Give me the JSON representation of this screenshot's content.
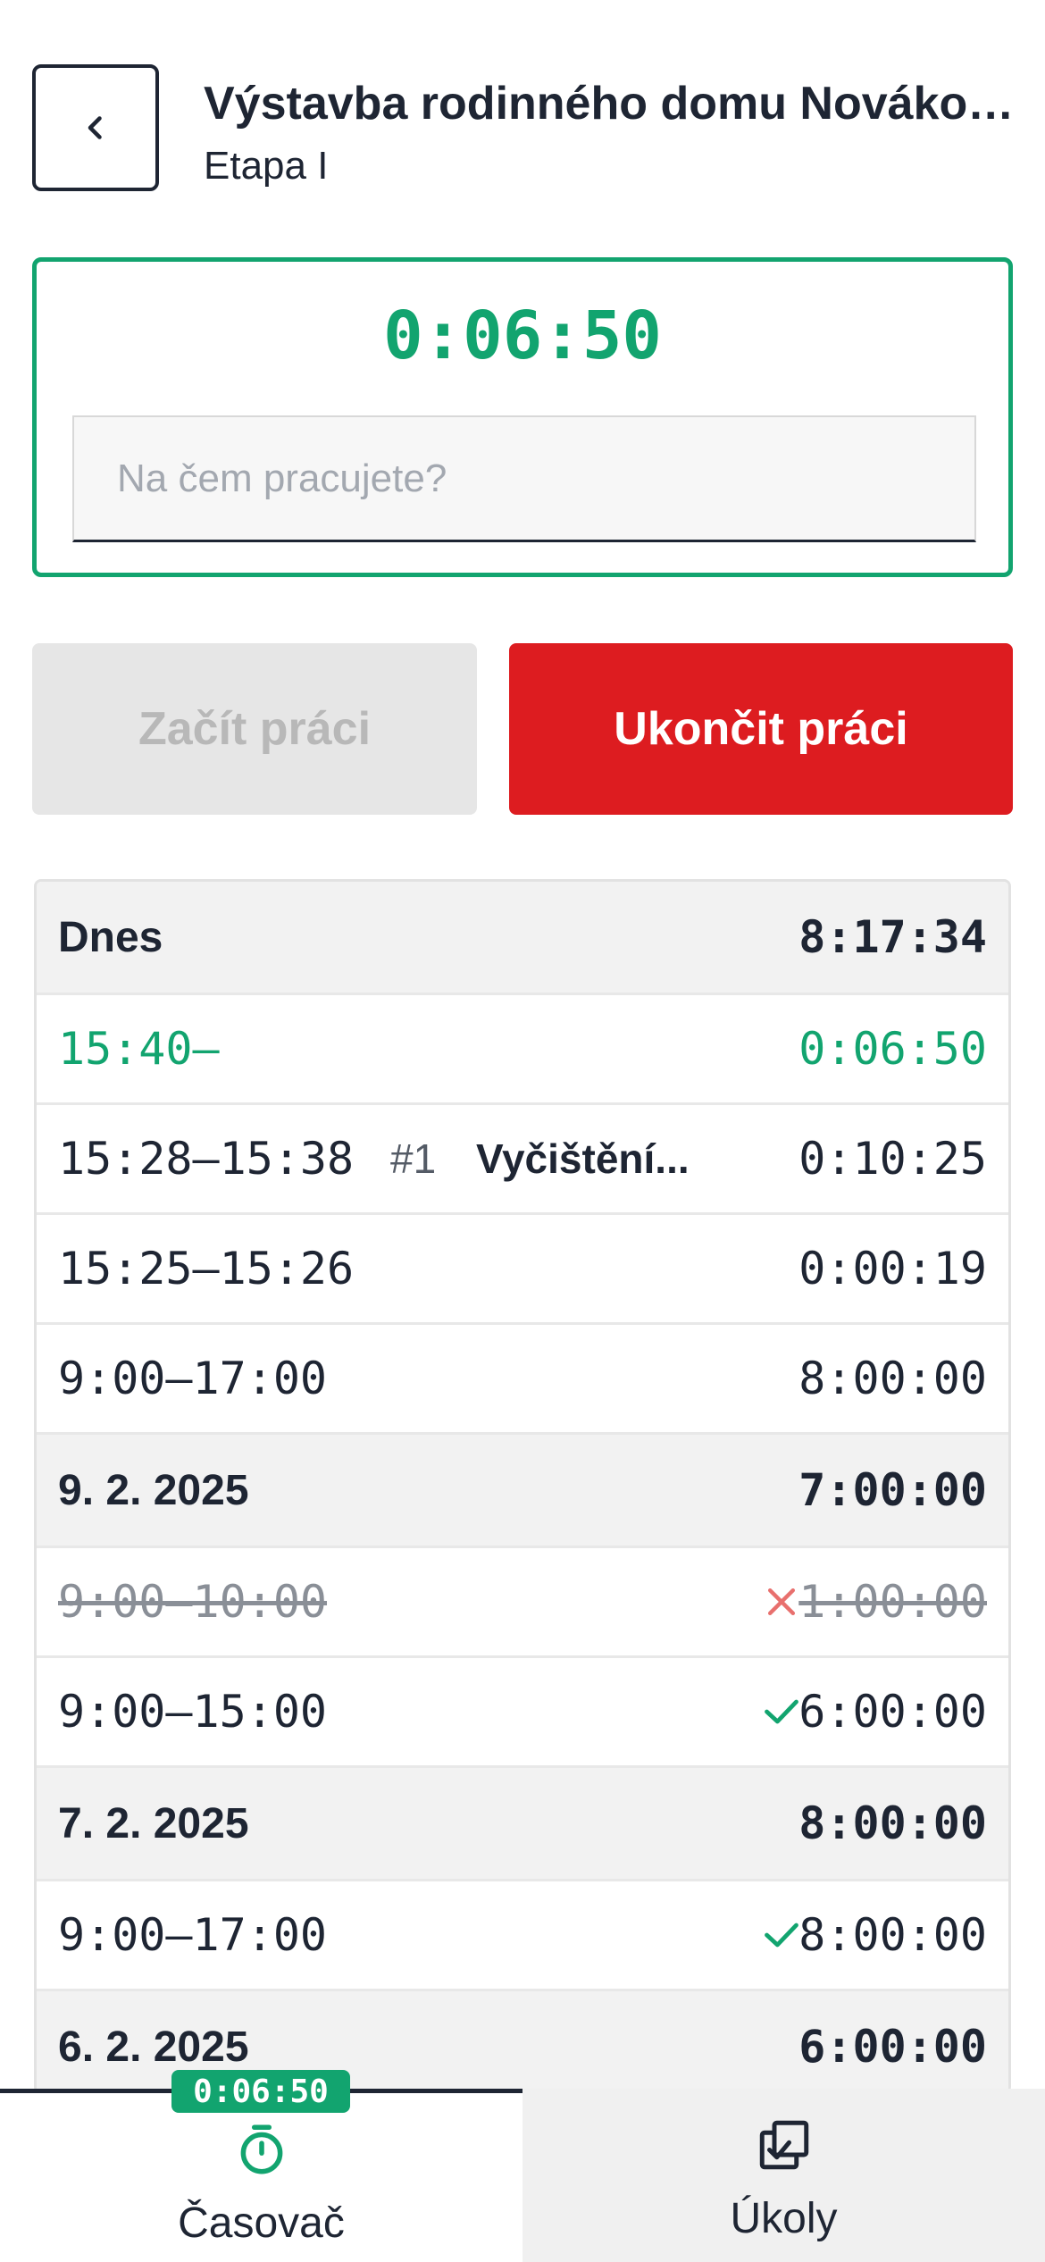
{
  "header": {
    "title": "Výstavba rodinného domu Novákových",
    "subtitle": "Etapa I"
  },
  "timer": {
    "elapsed": "0:06:50",
    "task_placeholder": "Na čem pracujete?",
    "task_value": ""
  },
  "actions": {
    "start_label": "Začít práci",
    "stop_label": "Ukončit práci"
  },
  "entries": {
    "today": {
      "label": "Dnes",
      "total": "8:17:34",
      "rows": [
        {
          "range": "15:40–",
          "duration": "0:06:50"
        },
        {
          "range": "15:28–15:38",
          "task_number": "#1",
          "task_name": "Vyčištění...",
          "duration": "0:10:25"
        },
        {
          "range": "15:25–15:26",
          "duration": "0:00:19"
        },
        {
          "range": "9:00–17:00",
          "duration": "8:00:00"
        }
      ]
    },
    "day_9_2": {
      "label": "9. 2. 2025",
      "total": "7:00:00",
      "rows": [
        {
          "range": "9:00–10:00",
          "duration": "1:00:00",
          "status_icon": "close-icon"
        },
        {
          "range": "9:00–15:00",
          "duration": "6:00:00",
          "status_icon": "check-icon"
        }
      ]
    },
    "day_7_2": {
      "label": "7. 2. 2025",
      "total": "8:00:00",
      "rows": [
        {
          "range": "9:00–17:00",
          "duration": "8:00:00",
          "status_icon": "check-icon"
        }
      ]
    },
    "day_6_2": {
      "label": "6. 2. 2025",
      "total": "6:00:00"
    }
  },
  "nav": {
    "timer_label": "Časovač",
    "timer_badge": "0:06:50",
    "tasks_label": "Úkoly"
  },
  "colors": {
    "accent_green": "#12a46f",
    "danger_red": "#dd1c20",
    "text_dark": "#1e2533"
  }
}
